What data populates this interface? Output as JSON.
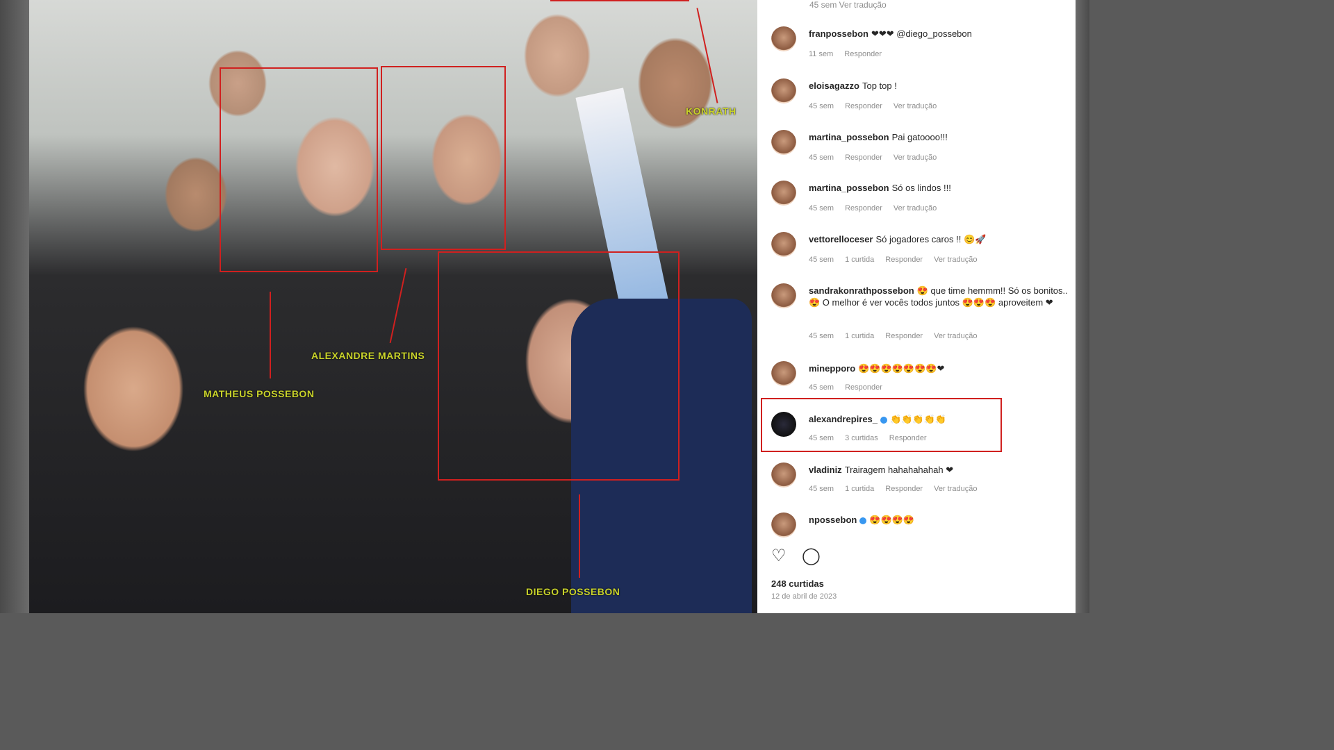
{
  "photo": {
    "labels": {
      "matheus": "MATHEUS POSSEBON",
      "alexandre": "ALEXANDRE MARTINS",
      "diego": "DIEGO POSSEBON",
      "konrath": "KONRATH"
    }
  },
  "post": {
    "top_meta": "45 sem   Ver tradução",
    "comments": [
      {
        "user": "franpossebon",
        "text": "❤❤❤ @diego_possebon",
        "meta": [
          "11 sem",
          "Responder"
        ]
      },
      {
        "user": "eloisagazzo",
        "text": "Top top !",
        "meta": [
          "45 sem",
          "Responder",
          "Ver tradução"
        ]
      },
      {
        "user": "martina_possebon",
        "text": "Pai gatoooo!!!",
        "meta": [
          "45 sem",
          "Responder",
          "Ver tradução"
        ]
      },
      {
        "user": "martina_possebon",
        "text": "Só os lindos !!!",
        "meta": [
          "45 sem",
          "Responder",
          "Ver tradução"
        ]
      },
      {
        "user": "vettorelloceser",
        "text": "Só jogadores caros !! 😊🚀",
        "meta": [
          "45 sem",
          "1 curtida",
          "Responder",
          "Ver tradução"
        ]
      },
      {
        "user": "sandrakonrathpossebon",
        "text": "😍 que time hemmm!! Só os bonitos.. 😍 O melhor é ver vocês todos juntos 😍😍😍 aproveitem ❤",
        "meta": [
          "45 sem",
          "1 curtida",
          "Responder",
          "Ver tradução"
        ]
      },
      {
        "user": "minepporo",
        "text": "😍😍😍😍😍😍😍❤",
        "meta": [
          "45 sem",
          "Responder"
        ]
      },
      {
        "user": "alexandrepires_",
        "text": "👏👏👏👏👏",
        "meta": [
          "45 sem",
          "3 curtidas",
          "Responder"
        ],
        "verified": true
      },
      {
        "user": "vladiniz",
        "text": "Trairagem hahahahahah ❤",
        "meta": [
          "45 sem",
          "1 curtida",
          "Responder",
          "Ver tradução"
        ]
      },
      {
        "user": "npossebon",
        "text": "😍😍😍😍",
        "meta": [],
        "verified": true
      }
    ],
    "actions": {
      "like_icon": "♡",
      "comment_icon": "◯"
    },
    "likes": "248 curtidas",
    "date": "12 de abril de 2023"
  }
}
